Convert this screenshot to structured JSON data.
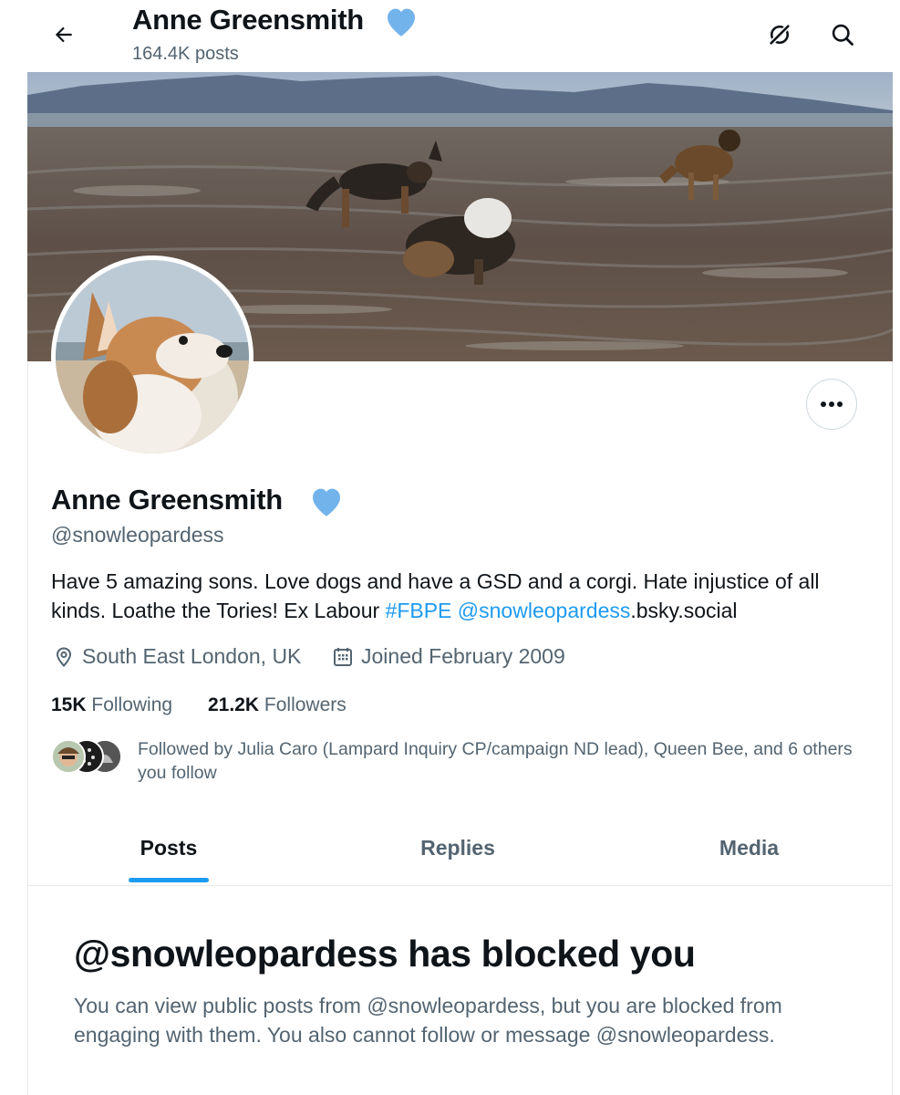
{
  "header": {
    "name": "Anne Greensmith",
    "posts_count": "164.4K posts"
  },
  "profile": {
    "name": "Anne Greensmith",
    "handle": "@snowleopardess",
    "bio_text_1": "Have 5 amazing sons. Love dogs and have a GSD and a corgi. Hate injustice of all kinds. Loathe the Tories! Ex Labour ",
    "bio_hashtag": "#FBPE",
    "bio_space": " ",
    "bio_mention": "@snowleopardess",
    "bio_text_2": ".bsky.social",
    "location": "South East London, UK",
    "joined": "Joined February 2009",
    "following_count": "15K",
    "following_label": "Following",
    "followers_count": "21.2K",
    "followers_label": "Followers",
    "followed_by": "Followed by Julia Caro (Lampard Inquiry CP/campaign ND lead), Queen Bee, and 6 others you follow"
  },
  "tabs": [
    {
      "label": "Posts",
      "active": true
    },
    {
      "label": "Replies",
      "active": false
    },
    {
      "label": "Media",
      "active": false
    }
  ],
  "blocked": {
    "title": "@snowleopardess has blocked you",
    "message": "You can view public posts from @snowleopardess, but you are blocked from engaging with them. You also cannot follow or message @snowleopardess."
  },
  "colors": {
    "accent": "#1d9bf0",
    "verified_badge": "#73b3ec",
    "secondary_text": "#536471",
    "primary_text": "#0f1419"
  },
  "icons": [
    "back-arrow-icon",
    "verified-heart-icon",
    "grok-icon",
    "search-icon",
    "more-icon",
    "location-icon",
    "calendar-icon"
  ]
}
